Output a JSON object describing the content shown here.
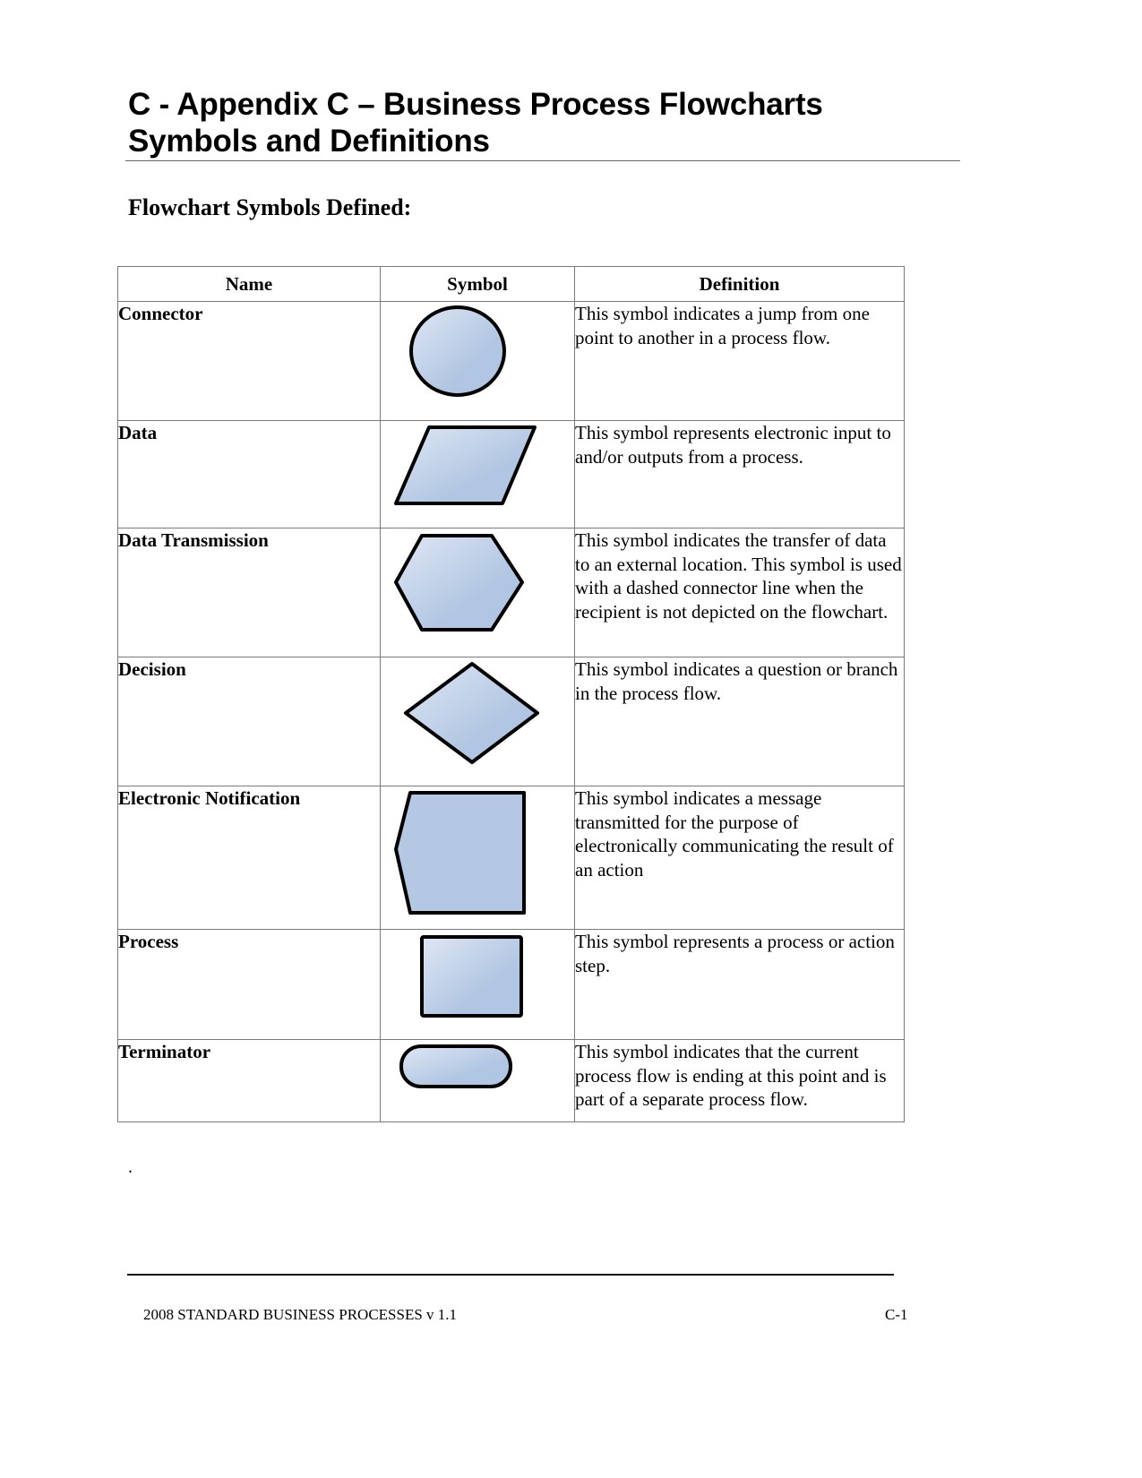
{
  "document": {
    "title_line1": "C - Appendix C – Business Process Flowcharts",
    "title_line2": "Symbols and Definitions",
    "subheading": "Flowchart Symbols Defined:",
    "stray_text": "."
  },
  "table": {
    "headers": {
      "name": "Name",
      "symbol": "Symbol",
      "definition": "Definition"
    },
    "rows": [
      {
        "name": "Connector",
        "symbol_icon": "connector-circle-icon",
        "definition": "This symbol indicates a jump from one point to another in a process flow."
      },
      {
        "name": "Data",
        "symbol_icon": "data-parallelogram-icon",
        "definition": "This symbol represents electronic input to and/or outputs from a process."
      },
      {
        "name": "Data Transmission",
        "symbol_icon": "data-transmission-hexagon-icon",
        "definition": "This symbol indicates the transfer of data to an external location. This symbol is used with a dashed connector line when the recipient is not depicted on the flowchart."
      },
      {
        "name": "Decision",
        "symbol_icon": "decision-diamond-icon",
        "definition": "This symbol indicates a question or branch in the process flow."
      },
      {
        "name": "Electronic Notification",
        "symbol_icon": "electronic-notification-icon",
        "definition": "This symbol indicates a message transmitted for the purpose of electronically communicating the result of an action"
      },
      {
        "name": "Process",
        "symbol_icon": "process-rectangle-icon",
        "definition": "This symbol represents a process or action step."
      },
      {
        "name": "Terminator",
        "symbol_icon": "terminator-rounded-icon",
        "definition": "This symbol indicates that the current process flow is ending at this point and is part of a separate process flow."
      }
    ]
  },
  "symbol_style": {
    "fill_light": "#dfe7f4",
    "fill_dark": "#b1c6e2",
    "fill_flat": "#b4c8e3",
    "stroke": "#000000"
  },
  "footer": {
    "left": "2008 STANDARD BUSINESS PROCESSES v 1.1",
    "right": "C-1"
  }
}
